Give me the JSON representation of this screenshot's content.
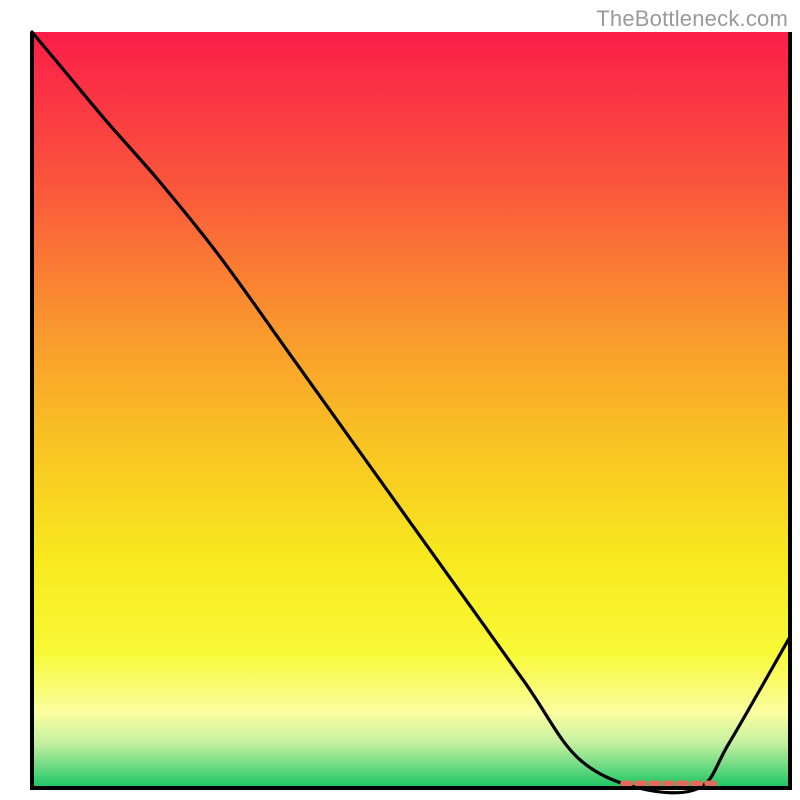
{
  "watermark": "TheBottleneck.com",
  "chart_data": {
    "type": "line",
    "title": "",
    "xlabel": "",
    "ylabel": "",
    "xlim": [
      0,
      100
    ],
    "ylim": [
      0,
      100
    ],
    "grid": false,
    "legend": false,
    "background": {
      "kind": "vertical-gradient",
      "stops": [
        {
          "offset": 0.0,
          "color": "#fb1d49"
        },
        {
          "offset": 0.2,
          "color": "#fa553c"
        },
        {
          "offset": 0.4,
          "color": "#f99a2d"
        },
        {
          "offset": 0.55,
          "color": "#f9c523"
        },
        {
          "offset": 0.7,
          "color": "#f8e91e"
        },
        {
          "offset": 0.82,
          "color": "#f8f936"
        },
        {
          "offset": 0.9,
          "color": "#fbfe9f"
        },
        {
          "offset": 0.94,
          "color": "#c5f0a0"
        },
        {
          "offset": 0.965,
          "color": "#7fdf88"
        },
        {
          "offset": 1.0,
          "color": "#19c564"
        }
      ]
    },
    "series": [
      {
        "name": "bottleneck-curve",
        "color": "#000000",
        "x": [
          0,
          5,
          10,
          17,
          25,
          35,
          45,
          55,
          65,
          72,
          80,
          88,
          92,
          100
        ],
        "values": [
          100,
          94,
          88,
          80,
          70,
          56,
          42,
          28,
          14,
          4,
          0,
          0,
          6,
          20
        ]
      }
    ],
    "marker": {
      "name": "optimal-range-marker",
      "x_range": [
        78,
        90
      ],
      "y": 0.6,
      "color": "#e46a5e"
    }
  }
}
